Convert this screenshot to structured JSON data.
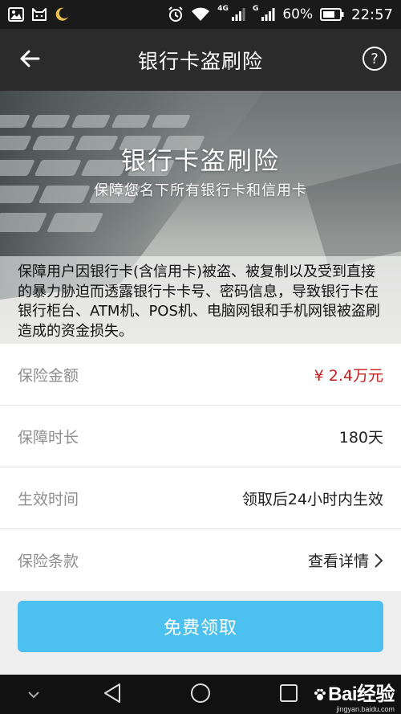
{
  "status_bar": {
    "network": "4G",
    "network_g": "G",
    "battery_percent": "60%",
    "time": "22:57"
  },
  "app_bar": {
    "title": "银行卡盗刷险",
    "help_label": "?"
  },
  "banner": {
    "title": "银行卡盗刷险",
    "subtitle": "保障您名下所有银行卡和信用卡",
    "description": "保障用户因银行卡(含信用卡)被盗、被复制以及受到直接的暴力胁迫而透露银行卡卡号、密码信息，导致银行卡在银行柜台、ATM机、POS机、电脑网银和手机网银被盗刷造成的资金损失。"
  },
  "rows": [
    {
      "label": "保险金额",
      "value": "¥ 2.4万元"
    },
    {
      "label": "保障时长",
      "value": "180天"
    },
    {
      "label": "生效时间",
      "value": "领取后24小时内生效"
    },
    {
      "label": "保险条款",
      "value": "查看详情"
    }
  ],
  "claim_button": {
    "label": "免费领取"
  },
  "watermark": {
    "brand": "Bai经验",
    "url": "jingyan.baidu.com"
  },
  "colors": {
    "accent_button": "#4cc0ee",
    "amount_red": "#c81e1e",
    "app_bar": "#2b2b2b",
    "status_bar": "#1a1a1a"
  },
  "icons": [
    "image-icon",
    "cat-icon",
    "moon-icon",
    "alarm-icon",
    "wifi-icon",
    "signal-icon",
    "battery-icon",
    "back-arrow-icon",
    "help-icon",
    "chevron-right-icon",
    "chevron-down-icon",
    "triangle-back-icon",
    "circle-home-icon",
    "square-recents-icon",
    "paw-icon"
  ]
}
